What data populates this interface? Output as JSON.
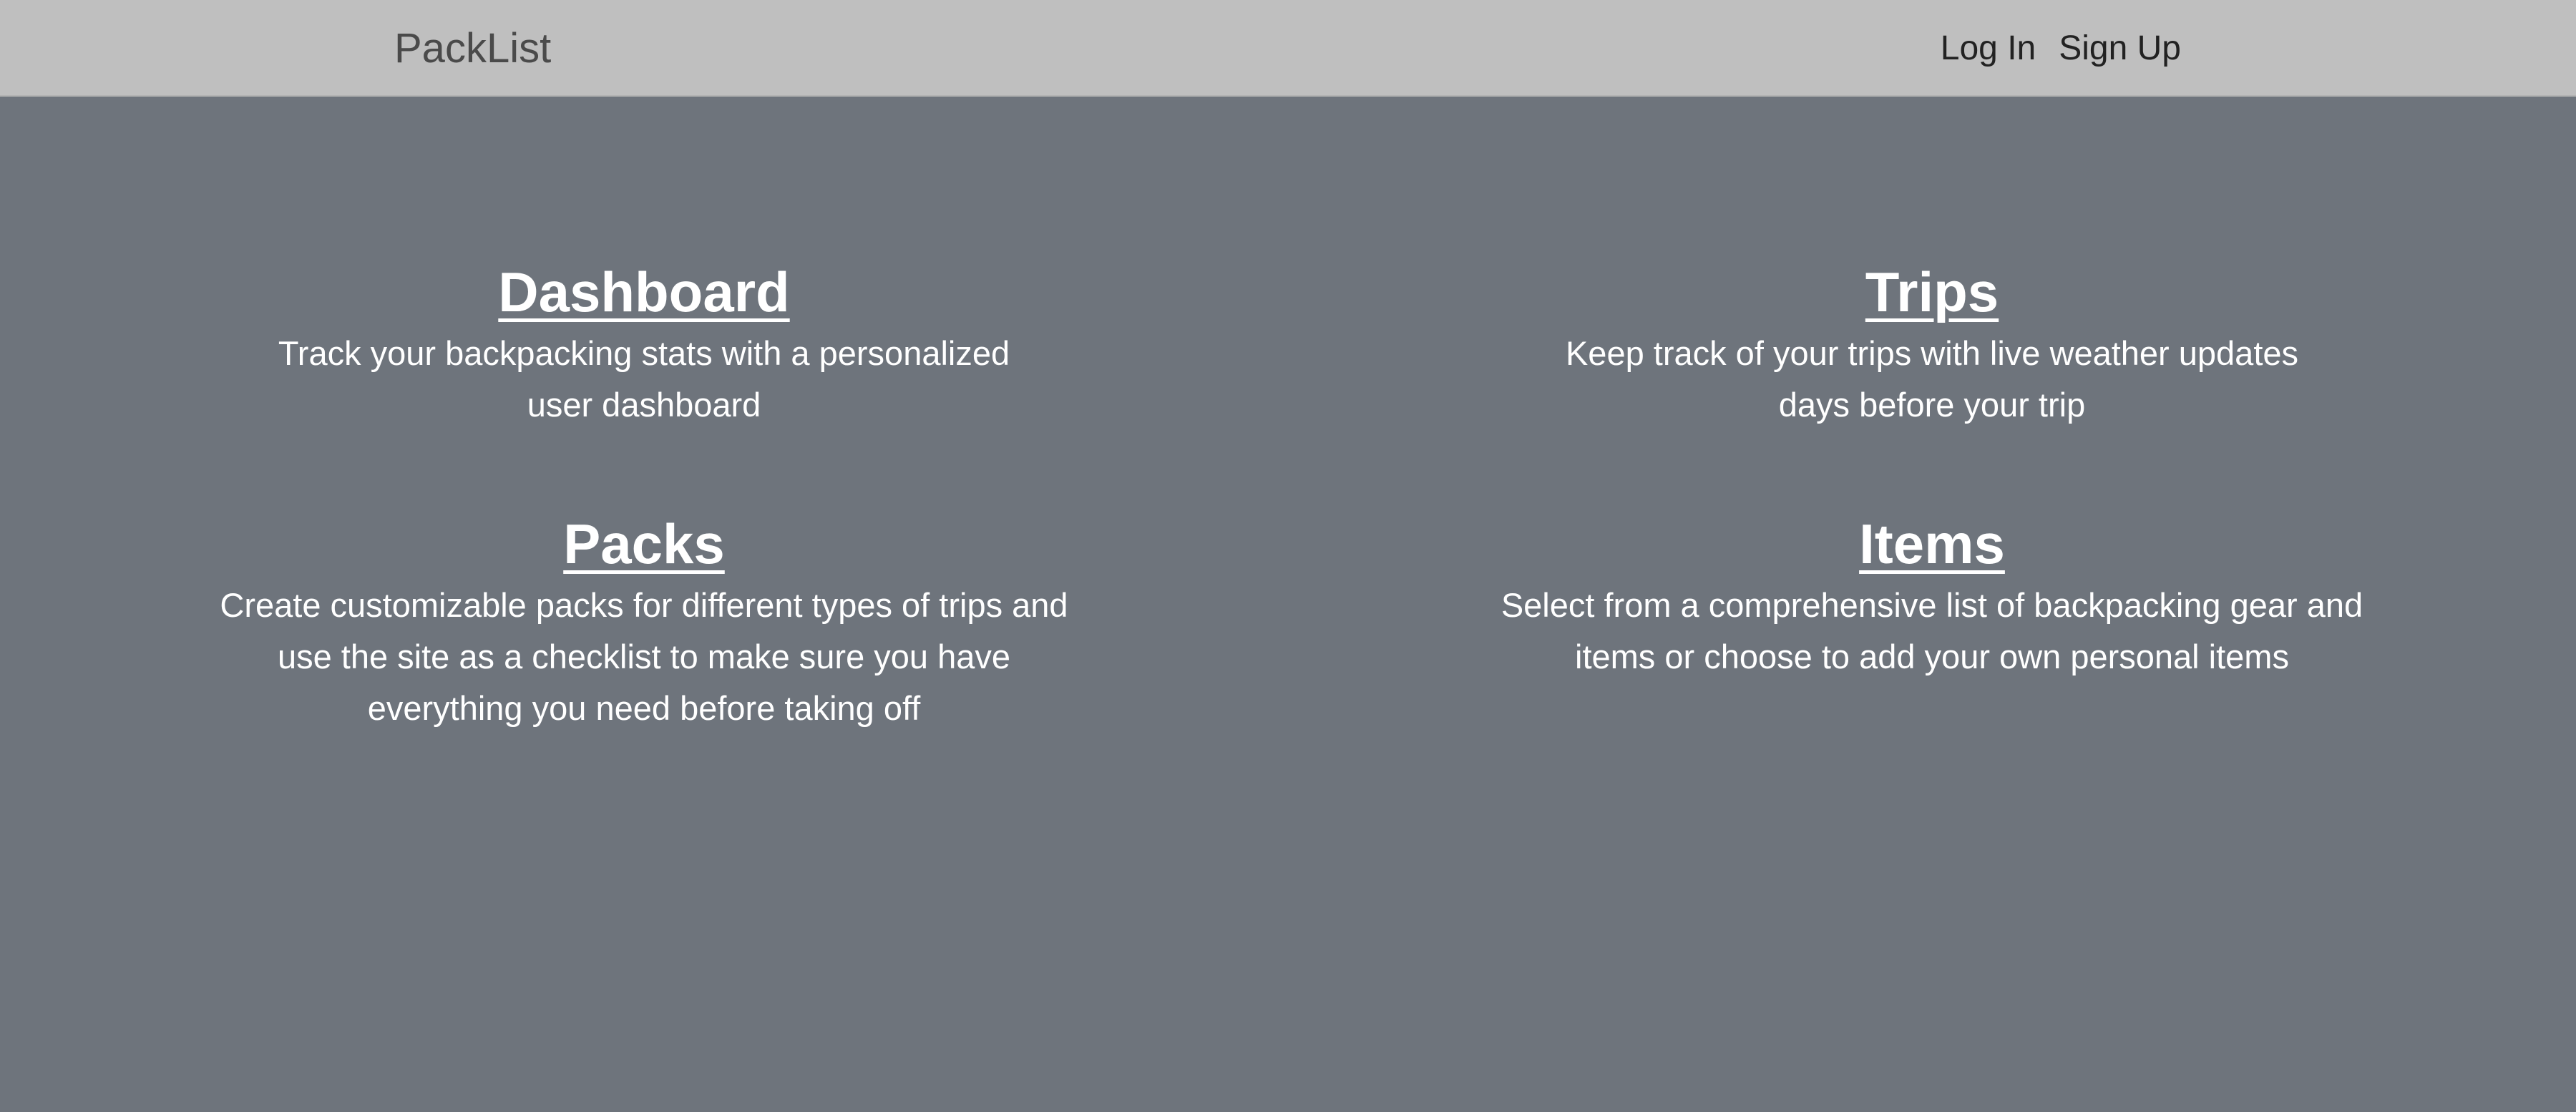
{
  "navbar": {
    "brand": "PackList",
    "links": [
      {
        "label": "Log In"
      },
      {
        "label": "Sign Up"
      }
    ]
  },
  "features": {
    "dashboard": {
      "title": "Dashboard",
      "description": "Track your backpacking stats with a personalized user dashboard"
    },
    "trips": {
      "title": "Trips",
      "description": "Keep track of your trips with live weather updates days before your trip"
    },
    "packs": {
      "title": "Packs",
      "description": "Create customizable packs for different types of trips and use the site as a checklist to make sure you have everything you need before taking off"
    },
    "items": {
      "title": "Items",
      "description": "Select from a comprehensive list of backpacking gear and items or choose to add your own personal items"
    }
  }
}
